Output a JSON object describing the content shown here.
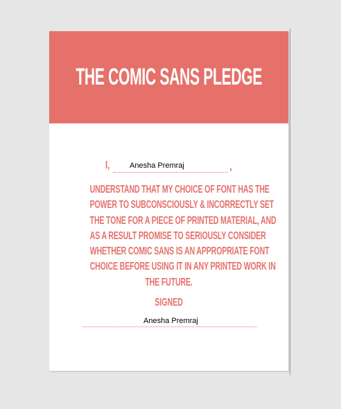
{
  "document": {
    "title": "THE COMIC SANS PLEDGE",
    "pronoun": "I,",
    "name_value": "Anesha Premraj",
    "comma": ",",
    "pledge_lines": [
      "UNDERSTAND THAT MY CHOICE OF FONT HAS THE",
      "POWER TO SUBCONSCIOUSLY & INCORRECTLY SET",
      "THE TONE FOR A PIECE OF PRINTED MATERIAL, AND",
      "AS A RESULT PROMISE TO SERIOUSLY CONSIDER",
      "WHETHER COMIC SANS IS AN APPROPRIATE FONT",
      "CHOICE BEFORE USING IT IN ANY PRINTED WORK IN",
      "THE FUTURE."
    ],
    "signed_label": "SIGNED",
    "signature_value": "Anesha Premraj"
  },
  "colors": {
    "accent": "#e5716a",
    "page_background": "#ffffff",
    "viewer_background": "#e6e6e6"
  }
}
